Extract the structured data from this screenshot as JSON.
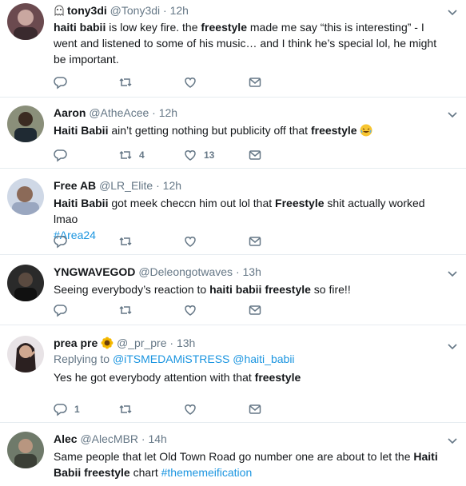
{
  "tweets": [
    {
      "name": "tony3di",
      "handle": "@Tony3di",
      "dot": "·",
      "time": "12h",
      "segments": [
        {
          "t": "haiti babii",
          "b": true
        },
        {
          "t": " is low key fire. the ",
          "b": false
        },
        {
          "t": "freestyle",
          "b": true
        },
        {
          "t": " made me say “this is interesting” - I went and listened to some of his music… and I think he’s special lol, he might be important.",
          "b": false
        }
      ],
      "replies": "",
      "retweets": "",
      "likes": ""
    },
    {
      "name": "Aaron",
      "handle": "@AtheAcee",
      "dot": "·",
      "time": "12h",
      "segments": [
        {
          "t": "Haiti Babii",
          "b": true
        },
        {
          "t": " ain’t getting nothing but publicity off that ",
          "b": false
        },
        {
          "t": "freestyle",
          "b": true
        }
      ],
      "emoji": "rolling-laughing-emoji",
      "replies": "",
      "retweets": "4",
      "likes": "13"
    },
    {
      "name": "Free AB",
      "handle": "@LR_Elite",
      "dot": "·",
      "time": "12h",
      "segments": [
        {
          "t": "Haiti Babii",
          "b": true
        },
        {
          "t": " got meek checcn him out lol that ",
          "b": false
        },
        {
          "t": "Freestyle",
          "b": true
        },
        {
          "t": " shit actually worked lmao",
          "b": false
        }
      ],
      "hashtag": "#Area24",
      "replies": "",
      "retweets": "",
      "likes": ""
    },
    {
      "name": "YNGWAVEGOD",
      "handle": "@Deleongotwaves",
      "dot": "·",
      "time": "13h",
      "segments": [
        {
          "t": "Seeing everybody’s reaction to ",
          "b": false
        },
        {
          "t": "haiti babii freestyle",
          "b": true
        },
        {
          "t": " so fire!!",
          "b": false
        }
      ],
      "replies": "",
      "retweets": "",
      "likes": ""
    },
    {
      "name": "prea pre",
      "handle": "@_pr_pre",
      "dot": "·",
      "time": "13h",
      "reply_label": "Replying to",
      "reply_mentions": "@iTSMEDAMiSTRESS @haiti_babii",
      "segments": [
        {
          "t": "Yes he got everybody attention with that ",
          "b": false
        },
        {
          "t": "freestyle",
          "b": true
        }
      ],
      "replies": "1",
      "retweets": "",
      "likes": ""
    },
    {
      "name": "Alec",
      "handle": "@AlecMBR",
      "dot": "·",
      "time": "14h",
      "segments": [
        {
          "t": "Same people that let Old Town Road go number one are about to let the ",
          "b": false
        },
        {
          "t": "Haiti Babii freestyle",
          "b": true
        },
        {
          "t": " chart ",
          "b": false
        }
      ],
      "hashtag": "#thememeification"
    }
  ],
  "colors": {
    "text": "#14171a",
    "secondary": "#657786",
    "link": "#1b95e0",
    "divider": "#e6ecf0"
  }
}
